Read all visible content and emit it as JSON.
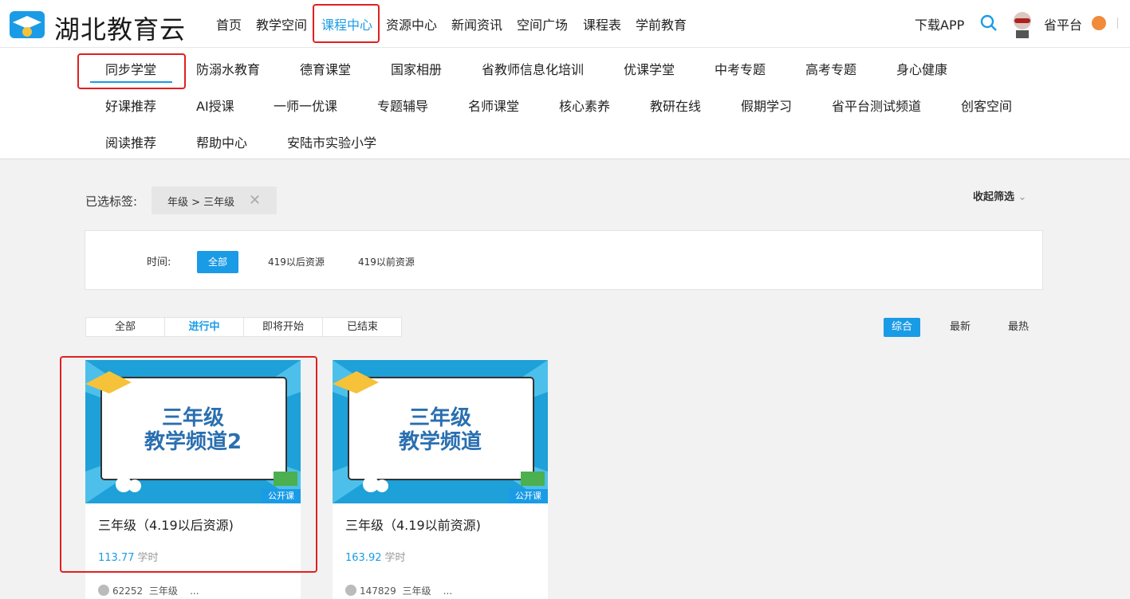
{
  "header": {
    "logo_text": "湖北教育云",
    "nav": [
      "首页",
      "教学空间",
      "课程中心",
      "资源中心",
      "新闻资讯",
      "空间广场",
      "课程表",
      "学前教育"
    ],
    "active_nav": "课程中心",
    "download": "下载APP",
    "platform": "省平台"
  },
  "subnav": {
    "rows": [
      [
        "同步学堂",
        "防溺水教育",
        "德育课堂",
        "国家相册",
        "省教师信息化培训",
        "优课学堂",
        "中考专题",
        "高考专题",
        "身心健康"
      ],
      [
        "好课推荐",
        "AI授课",
        "一师一优课",
        "专题辅导",
        "名师课堂",
        "核心素养",
        "教研在线",
        "假期学习",
        "省平台测试频道",
        "创客空间"
      ],
      [
        "阅读推荐",
        "帮助中心",
        "安陆市实验小学"
      ]
    ],
    "active": "同步学堂"
  },
  "filters": {
    "selected_label": "已选标签:",
    "selected_tag": "年级 > 三年级",
    "collapse": "收起筛选",
    "time_label": "时间:",
    "time_options": [
      "全部",
      "419以后资源",
      "419以前资源"
    ]
  },
  "status_tabs": [
    "全部",
    "进行中",
    "即将开始",
    "已结束"
  ],
  "active_status": "进行中",
  "sort": [
    "综合",
    "最新",
    "最热"
  ],
  "courses": [
    {
      "thumb_line1": "三年级",
      "thumb_line2": "教学频道2",
      "badge": "公开课",
      "title": "三年级（4.19以后资源)",
      "hours": "113.77",
      "hours_unit": "学时",
      "views": "62252",
      "grade": "三年级",
      "more": "..."
    },
    {
      "thumb_line1": "三年级",
      "thumb_line2": "教学频道",
      "badge": "公开课",
      "title": "三年级（4.19以前资源)",
      "hours": "163.92",
      "hours_unit": "学时",
      "views": "147829",
      "grade": "三年级",
      "more": "..."
    }
  ],
  "colors": {
    "accent": "#1a9be6",
    "highlight": "#e02020"
  }
}
